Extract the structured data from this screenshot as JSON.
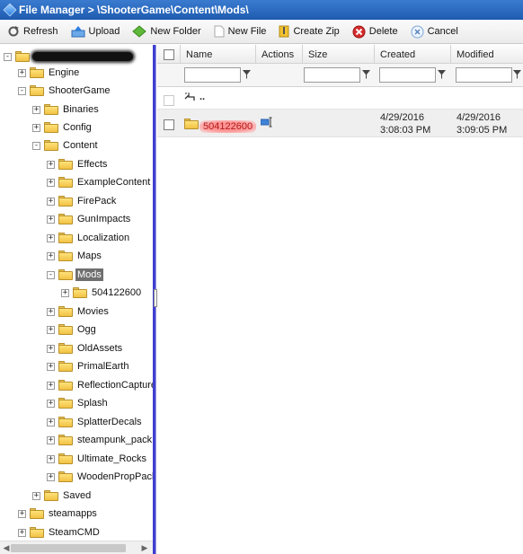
{
  "window": {
    "title": "File Manager > \\ShooterGame\\Content\\Mods\\"
  },
  "toolbar": {
    "refresh": "Refresh",
    "upload": "Upload",
    "new_folder": "New Folder",
    "new_file": "New File",
    "create_zip": "Create Zip",
    "delete": "Delete",
    "cancel": "Cancel"
  },
  "tree": {
    "root_label": "",
    "items": [
      {
        "label": "Engine",
        "expander": "+"
      },
      {
        "label": "ShooterGame",
        "expander": "-"
      },
      {
        "label": "Binaries",
        "expander": "+"
      },
      {
        "label": "Config",
        "expander": "+"
      },
      {
        "label": "Content",
        "expander": "-"
      },
      {
        "label": "Effects",
        "expander": "+"
      },
      {
        "label": "ExampleContent",
        "expander": "+"
      },
      {
        "label": "FirePack",
        "expander": "+"
      },
      {
        "label": "GunImpacts",
        "expander": "+"
      },
      {
        "label": "Localization",
        "expander": "+"
      },
      {
        "label": "Maps",
        "expander": "+"
      },
      {
        "label": "Mods",
        "expander": "-"
      },
      {
        "label": "504122600",
        "expander": "+"
      },
      {
        "label": "Movies",
        "expander": "+"
      },
      {
        "label": "Ogg",
        "expander": "+"
      },
      {
        "label": "OldAssets",
        "expander": "+"
      },
      {
        "label": "PrimalEarth",
        "expander": "+"
      },
      {
        "label": "ReflectionCapture",
        "expander": "+"
      },
      {
        "label": "Splash",
        "expander": "+"
      },
      {
        "label": "SplatterDecals",
        "expander": "+"
      },
      {
        "label": "steampunk_pack",
        "expander": "+"
      },
      {
        "label": "Ultimate_Rocks",
        "expander": "+"
      },
      {
        "label": "WoodenPropPack",
        "expander": "+"
      },
      {
        "label": "Saved",
        "expander": "+"
      },
      {
        "label": "steamapps",
        "expander": "+"
      },
      {
        "label": "SteamCMD",
        "expander": "+"
      }
    ]
  },
  "grid": {
    "columns": {
      "name": "Name",
      "actions": "Actions",
      "size": "Size",
      "created": "Created",
      "modified": "Modified"
    },
    "up_label": "..",
    "rows": [
      {
        "name": "504122600",
        "size": "",
        "created_date": "4/29/2016",
        "created_time": "3:08:03 PM",
        "modified_date": "4/29/2016",
        "modified_time": "3:09:05 PM"
      }
    ]
  },
  "colors": {
    "titlebar": "#2a6cc4",
    "selected_tree": "#6f6f6f",
    "highlight": "#ff8f8f",
    "splitter": "#3f3fd0"
  }
}
